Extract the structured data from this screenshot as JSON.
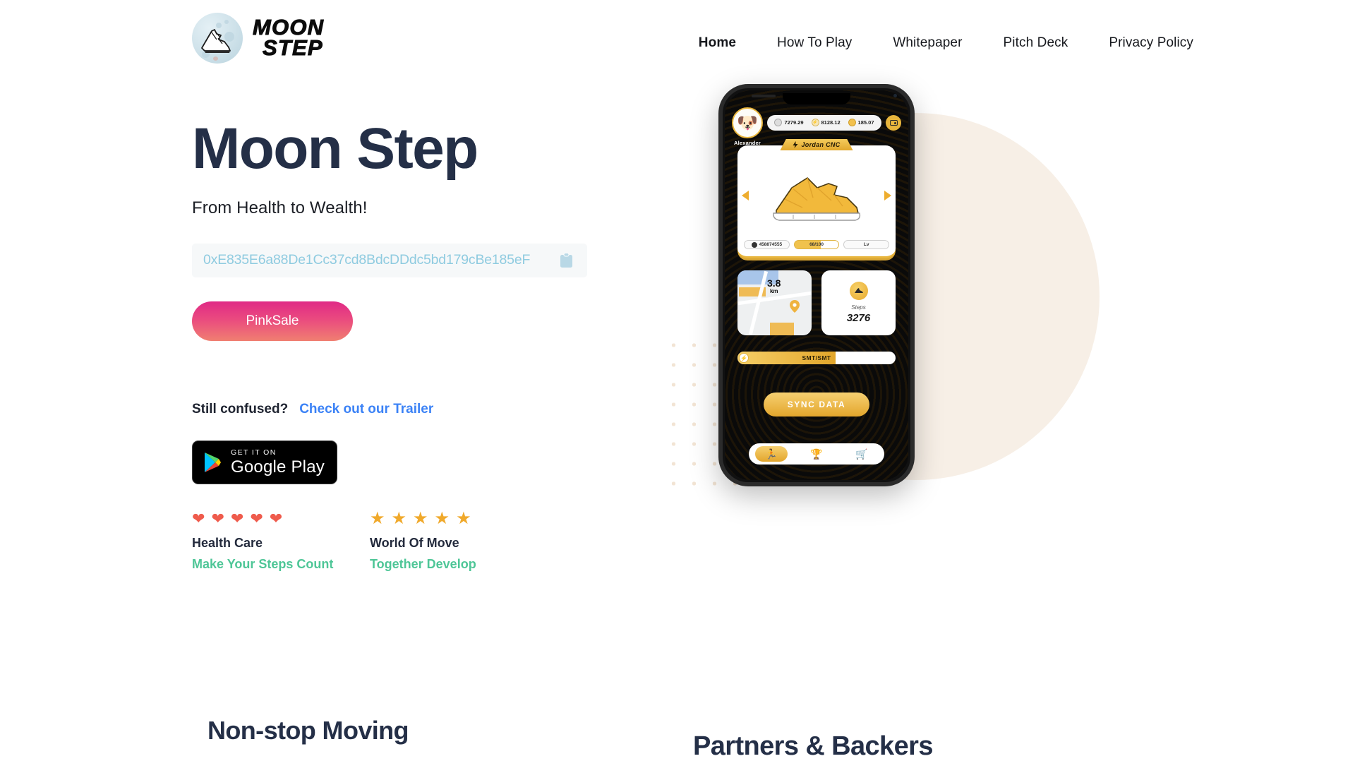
{
  "header": {
    "brand": {
      "line1": "MOON",
      "line2": "STEP",
      "logo_icon": "moon-shoe-logo"
    },
    "nav": [
      {
        "label": "Home",
        "active": true
      },
      {
        "label": "How To Play",
        "active": false
      },
      {
        "label": "Whitepaper",
        "active": false
      },
      {
        "label": "Pitch Deck",
        "active": false
      },
      {
        "label": "Privacy Policy",
        "active": false
      }
    ]
  },
  "hero": {
    "title": "Moon Step",
    "subtitle": "From Health to Wealth!",
    "contract_address": "0xE835E6a88De1Cc37cd8BdcDDdc5bd179cBe185eF",
    "copy_icon": "clipboard-icon",
    "cta_label": "PinkSale",
    "confused_text": "Still confused?",
    "trailer_link": "Check out our Trailer",
    "google_play": {
      "small": "GET IT ON",
      "big": "Google Play"
    },
    "features": [
      {
        "icon": "heart-icon",
        "icon_count": 5,
        "title": "Health Care",
        "subtitle": "Make Your Steps Count"
      },
      {
        "icon": "star-icon",
        "icon_count": 5,
        "title": "World Of Move",
        "subtitle": "Together Develop"
      }
    ],
    "colors": {
      "title": "#242F47",
      "address": "#8FCBE0",
      "cta_gradient_start": "#E02A86",
      "cta_gradient_end": "#F07F71",
      "link_blue": "#3B82F6",
      "feature_sub_green": "#4EC697",
      "heart_red": "#EF5B4C",
      "star_gold": "#F0A92B"
    }
  },
  "phone_app": {
    "user_name": "Alexander",
    "avatar_icon": "dog-avatar-icon",
    "stats": [
      {
        "icon": "sneaker-token-icon",
        "value": "7279.29"
      },
      {
        "icon": "energy-token-icon",
        "value": "8128.12"
      },
      {
        "icon": "coin-token-icon",
        "value": "185.07"
      }
    ],
    "wallet_icon": "wallet-icon",
    "shoe": {
      "tab_icon": "lightning-icon",
      "tab_label": "Jordan CNC",
      "art_icon": "sneaker-icon",
      "prev_icon": "arrow-left-icon",
      "next_icon": "arrow-right-icon",
      "pills": [
        {
          "icon": "id-icon",
          "label": "458874555"
        },
        {
          "icon": "durability-icon",
          "label": "68/100"
        },
        {
          "icon": "level-icon",
          "label": "Lv"
        }
      ]
    },
    "distance": {
      "value": "3.8",
      "unit": "km",
      "pin_icon": "map-pin-icon"
    },
    "steps": {
      "icon": "shoe-badge-icon",
      "label": "Steps",
      "value": "3276"
    },
    "progress": {
      "icon": "bolt-icon",
      "label": "SMT/SMT"
    },
    "sync_button": "SYNC DATA",
    "tabs": [
      {
        "icon": "running-icon",
        "active": true
      },
      {
        "icon": "podium-icon",
        "active": false
      },
      {
        "icon": "cart-icon",
        "active": false
      }
    ]
  },
  "sections": {
    "non_stop_moving": "Non-stop Moving",
    "partners_backers": "Partners & Backers"
  }
}
